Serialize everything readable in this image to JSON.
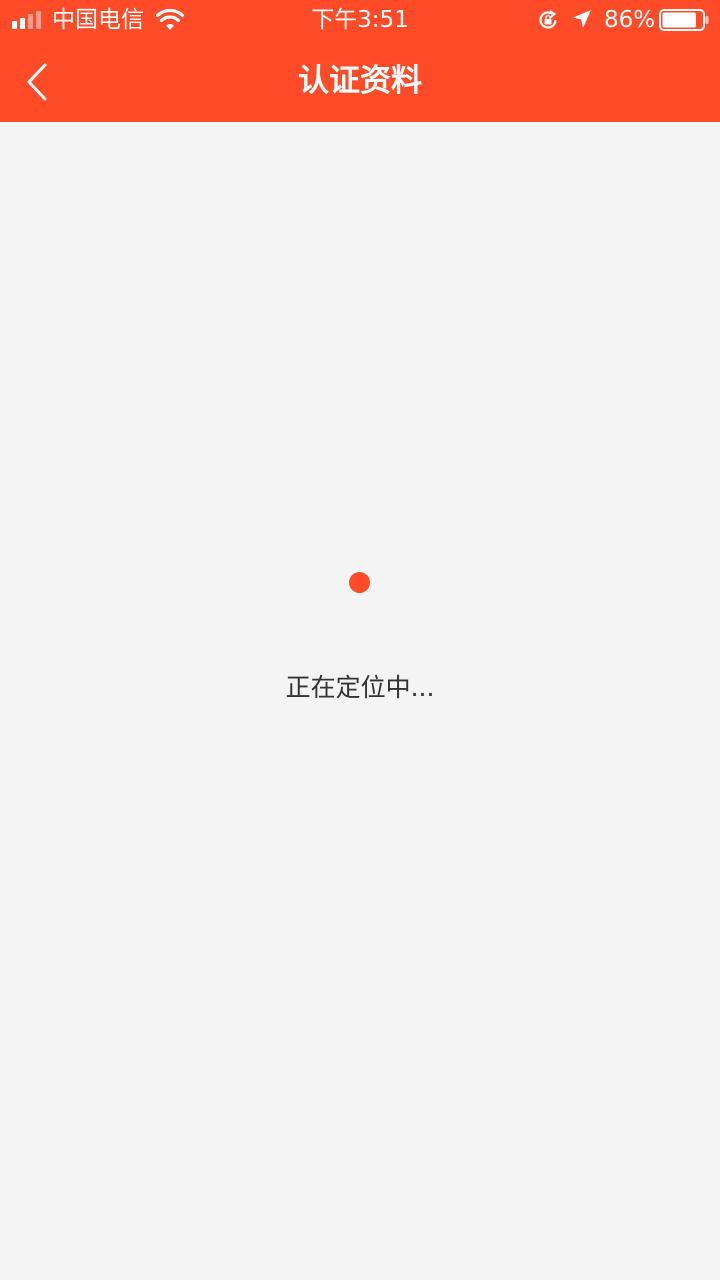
{
  "status_bar": {
    "carrier": "中国电信",
    "time": "下午3:51",
    "battery_percent": "86%",
    "battery_level": 0.86,
    "icons": [
      "signal-icon",
      "wifi-icon",
      "rotation-lock-icon",
      "location-arrow-icon",
      "battery-icon"
    ]
  },
  "nav": {
    "title": "认证资料",
    "back_icon": "chevron-left-icon"
  },
  "main": {
    "loading_text": "正在定位中..."
  },
  "colors": {
    "accent": "#ff4b28",
    "background": "#f4f4f4",
    "text": "#333333"
  }
}
